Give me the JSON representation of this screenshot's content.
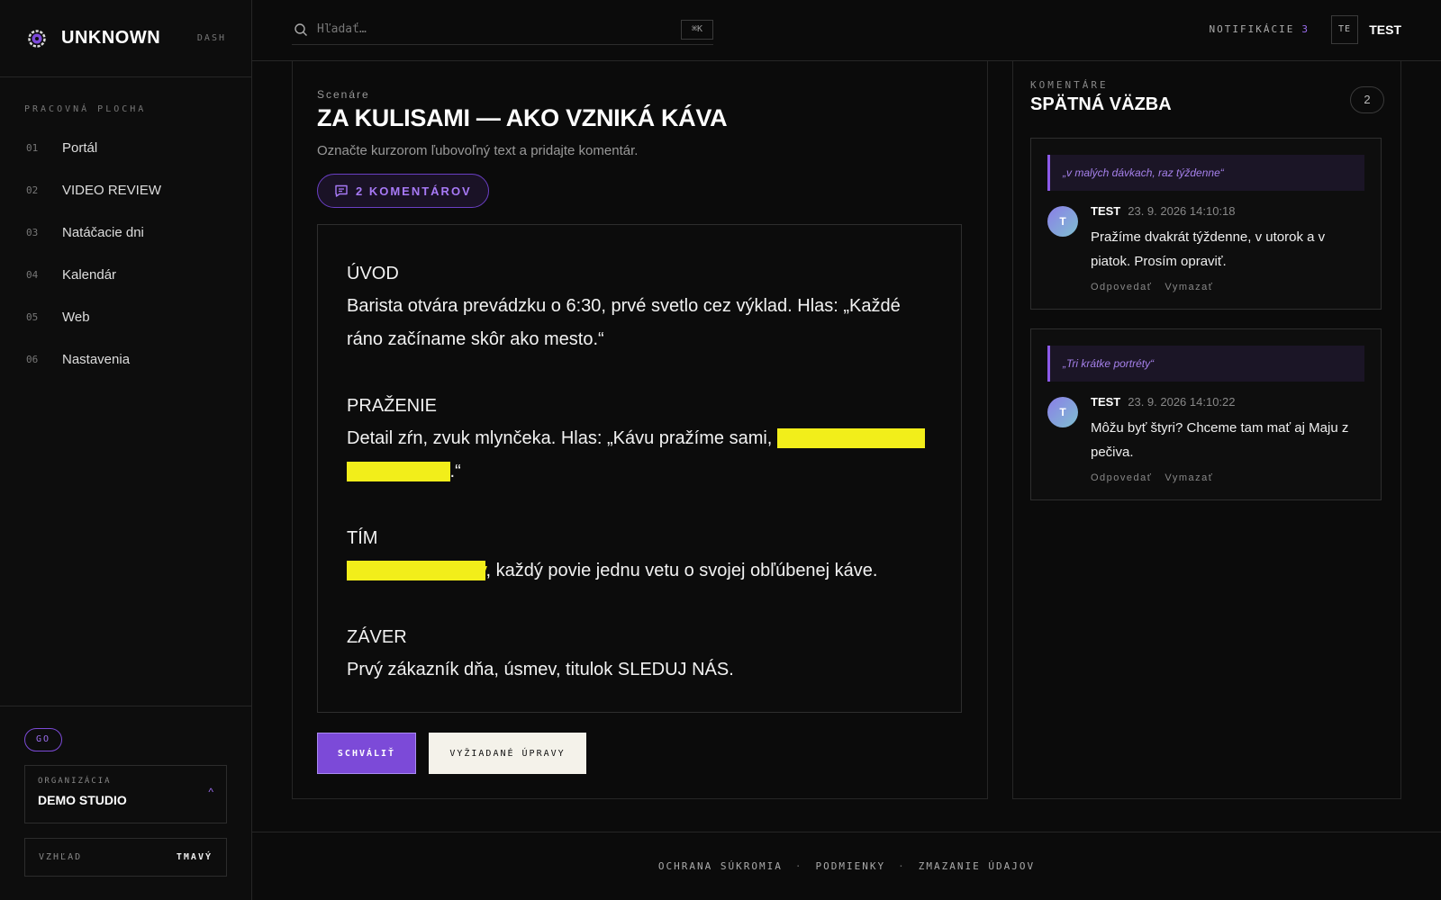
{
  "brand": {
    "name": "UNKNOWN",
    "tag": "DASH"
  },
  "nav": {
    "heading": "PRACOVNÁ PLOCHA",
    "items": [
      {
        "num": "01",
        "label": "Portál"
      },
      {
        "num": "02",
        "label": "VIDEO REVIEW"
      },
      {
        "num": "03",
        "label": "Natáčacie dni"
      },
      {
        "num": "04",
        "label": "Kalendár"
      },
      {
        "num": "05",
        "label": "Web"
      },
      {
        "num": "06",
        "label": "Nastavenia"
      }
    ]
  },
  "sidebar_bottom": {
    "badge": "GO",
    "org_label": "ORGANIZÁCIA",
    "org_value": "DEMO STUDIO",
    "org_caret": "^",
    "theme_label": "VZHĽAD",
    "theme_value": "TMAVÝ"
  },
  "topbar": {
    "search_placeholder": "Hľadať…",
    "shortcut": "⌘K",
    "notifications_label": "NOTIFIKÁCIE",
    "notifications_count": "3",
    "user_initials": "TE",
    "user_name": "TEST"
  },
  "script": {
    "eyebrow": "Scenáre",
    "title": "ZA KULISAMI — AKO VZNIKÁ KÁVA",
    "subtitle": "Označte kurzorom ľubovoľný text a pridajte komentár.",
    "comments_button": "2 KOMENTÁROV",
    "scenes": {
      "s1_head": "ÚVOD",
      "s1_body": "Barista otvára prevádzku o 6:30, prvé svetlo cez výklad. Hlas: „Každé ráno začíname skôr ako mesto.“",
      "s2_head": "PRAŽENIE",
      "s2_body_a": "Detail zŕn, zvuk mlynčeka. Hlas: „Kávu pražíme sami, ",
      "s2_body_hl": "v malých dávkach, raz týždenne",
      "s2_body_b": ".“",
      "s3_head": "TÍM",
      "s3_body_hl": "Tri krátke portréty",
      "s3_body_b": ", každý povie jednu vetu o svojej obľúbenej káve.",
      "s4_head": "ZÁVER",
      "s4_body": "Prvý zákazník dňa, úsmev, titulok SLEDUJ NÁS."
    },
    "approve_label": "SCHVÁLIŤ",
    "changes_label": "VYŽIADANÉ ÚPRAVY"
  },
  "comments": {
    "eyebrow": "KOMENTÁRE",
    "title": "SPÄTNÁ VÄZBA",
    "count": "2",
    "items": [
      {
        "quote": "„v malých dávkach, raz týždenne“",
        "avatar": "T",
        "author": "TEST",
        "time": "23. 9. 2026 14:10:18",
        "text": "Pražíme dvakrát týždenne, v utorok a v piatok. Prosím opraviť.",
        "reply": "Odpovedať",
        "delete": "Vymazať"
      },
      {
        "quote": "„Tri krátke portréty“",
        "avatar": "T",
        "author": "TEST",
        "time": "23. 9. 2026 14:10:22",
        "text": "Môžu byť štyri? Chceme tam mať aj Maju z pečiva.",
        "reply": "Odpovedať",
        "delete": "Vymazať"
      }
    ]
  },
  "footer": {
    "privacy": "OCHRANA SÚKROMIA",
    "terms": "PODMIENKY",
    "delete_data": "ZMAZANIE ÚDAJOV",
    "separator": "·"
  },
  "colors": {
    "accent": "#7c4ad8",
    "highlight": "#f2ee1a",
    "background": "#0b0b0b"
  }
}
